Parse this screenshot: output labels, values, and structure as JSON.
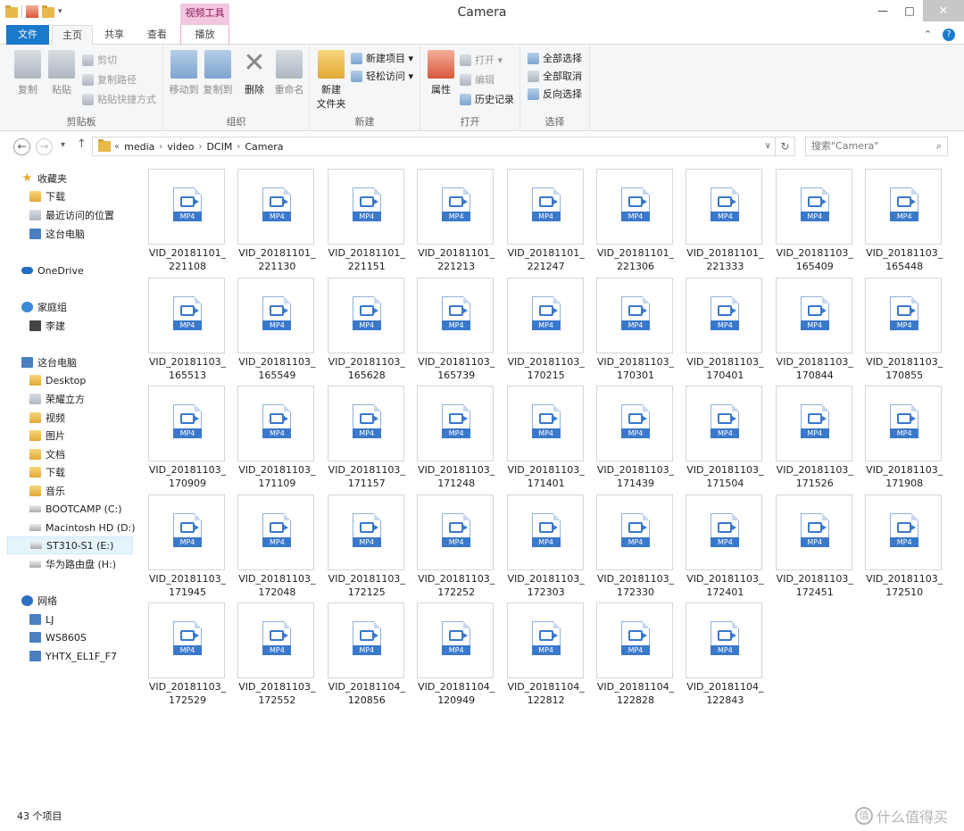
{
  "window": {
    "title": "Camera",
    "minimize": "—",
    "maximize": "□",
    "close": "✕"
  },
  "ribbon_tabs": {
    "file": "文件",
    "home": "主页",
    "share": "共享",
    "view": "查看",
    "context_group": "视频工具",
    "play": "播放",
    "expand": "⌃",
    "help": "?"
  },
  "ribbon": {
    "clipboard": {
      "label": "剪贴板",
      "copy": "复制",
      "paste": "粘贴",
      "cut": "剪切",
      "copy_path": "复制路径",
      "paste_shortcut": "粘贴快捷方式"
    },
    "organize": {
      "label": "组织",
      "move_to": "移动到",
      "copy_to": "复制到",
      "delete": "删除",
      "rename": "重命名"
    },
    "new": {
      "label": "新建",
      "new_folder_line1": "新建",
      "new_folder_line2": "文件夹",
      "new_item": "新建项目 ▾",
      "easy_access": "轻松访问 ▾"
    },
    "open": {
      "label": "打开",
      "properties": "属性",
      "open": "打开 ▾",
      "edit": "编辑",
      "history": "历史记录"
    },
    "select": {
      "label": "选择",
      "select_all": "全部选择",
      "select_none": "全部取消",
      "invert": "反向选择"
    }
  },
  "address": {
    "overflow": "«",
    "crumbs": [
      "media",
      "video",
      "DCIM",
      "Camera"
    ],
    "search_placeholder": "搜索\"Camera\""
  },
  "nav_pane": [
    {
      "label": "收藏夹",
      "icon": "star-icon"
    },
    {
      "label": "下载",
      "icon": "folder-icon"
    },
    {
      "label": "最近访问的位置",
      "icon": "recent-places-icon"
    },
    {
      "label": "这台电脑",
      "icon": "computer-icon"
    },
    {
      "label": "OneDrive",
      "icon": "cloud-icon"
    },
    {
      "label": "家庭组",
      "icon": "homegroup-icon"
    },
    {
      "label": "李建",
      "icon": "user-icon"
    },
    {
      "label": "这台电脑",
      "icon": "computer-icon"
    },
    {
      "label": "Desktop",
      "icon": "folder-icon"
    },
    {
      "label": "荣耀立方",
      "icon": "device-icon"
    },
    {
      "label": "视频",
      "icon": "folder-icon"
    },
    {
      "label": "图片",
      "icon": "folder-icon"
    },
    {
      "label": "文档",
      "icon": "folder-icon"
    },
    {
      "label": "下载",
      "icon": "folder-icon"
    },
    {
      "label": "音乐",
      "icon": "folder-icon"
    },
    {
      "label": "BOOTCAMP (C:)",
      "icon": "drive-icon"
    },
    {
      "label": "Macintosh HD (D:)",
      "icon": "drive-icon"
    },
    {
      "label": "ST310-S1 (E:)",
      "icon": "drive-icon",
      "selected": true
    },
    {
      "label": "华为路由盘 (H:)",
      "icon": "network-drive-icon"
    },
    {
      "label": "网络",
      "icon": "network-icon"
    },
    {
      "label": "LJ",
      "icon": "computer-icon"
    },
    {
      "label": "WS860S",
      "icon": "computer-icon"
    },
    {
      "label": "YHTX_EL1F_F7",
      "icon": "computer-icon"
    }
  ],
  "file_badge": "MP4",
  "files": [
    [
      "VID_20181101_",
      "221108"
    ],
    [
      "VID_20181101_",
      "221130"
    ],
    [
      "VID_20181101_",
      "221151"
    ],
    [
      "VID_20181101_",
      "221213"
    ],
    [
      "VID_20181101_",
      "221247"
    ],
    [
      "VID_20181101_",
      "221306"
    ],
    [
      "VID_20181101_",
      "221333"
    ],
    [
      "VID_20181103_",
      "165409"
    ],
    [
      "VID_20181103_",
      "165448"
    ],
    [
      "VID_20181103_",
      "165513"
    ],
    [
      "VID_20181103_",
      "165549"
    ],
    [
      "VID_20181103_",
      "165628"
    ],
    [
      "VID_20181103_",
      "165739"
    ],
    [
      "VID_20181103_",
      "170215"
    ],
    [
      "VID_20181103_",
      "170301"
    ],
    [
      "VID_20181103_",
      "170401"
    ],
    [
      "VID_20181103_",
      "170844"
    ],
    [
      "VID_20181103_",
      "170855"
    ],
    [
      "VID_20181103_",
      "170909"
    ],
    [
      "VID_20181103_",
      "171109"
    ],
    [
      "VID_20181103_",
      "171157"
    ],
    [
      "VID_20181103_",
      "171248"
    ],
    [
      "VID_20181103_",
      "171401"
    ],
    [
      "VID_20181103_",
      "171439"
    ],
    [
      "VID_20181103_",
      "171504"
    ],
    [
      "VID_20181103_",
      "171526"
    ],
    [
      "VID_20181103_",
      "171908"
    ],
    [
      "VID_20181103_",
      "171945"
    ],
    [
      "VID_20181103_",
      "172048"
    ],
    [
      "VID_20181103_",
      "172125"
    ],
    [
      "VID_20181103_",
      "172252"
    ],
    [
      "VID_20181103_",
      "172303"
    ],
    [
      "VID_20181103_",
      "172330"
    ],
    [
      "VID_20181103_",
      "172401"
    ],
    [
      "VID_20181103_",
      "172451"
    ],
    [
      "VID_20181103_",
      "172510"
    ],
    [
      "VID_20181103_",
      "172529"
    ],
    [
      "VID_20181103_",
      "172552"
    ],
    [
      "VID_20181104_",
      "120856"
    ],
    [
      "VID_20181104_",
      "120949"
    ],
    [
      "VID_20181104_",
      "122812"
    ],
    [
      "VID_20181104_",
      "122828"
    ],
    [
      "VID_20181104_",
      "122843"
    ]
  ],
  "status": {
    "count": "43 个项目"
  },
  "watermark": {
    "badge": "值",
    "text": "什么值得买"
  },
  "colors": {
    "accent": "#1979ca",
    "context_tab": "#f3c6e0",
    "mp4_badge": "#3a78cc"
  }
}
